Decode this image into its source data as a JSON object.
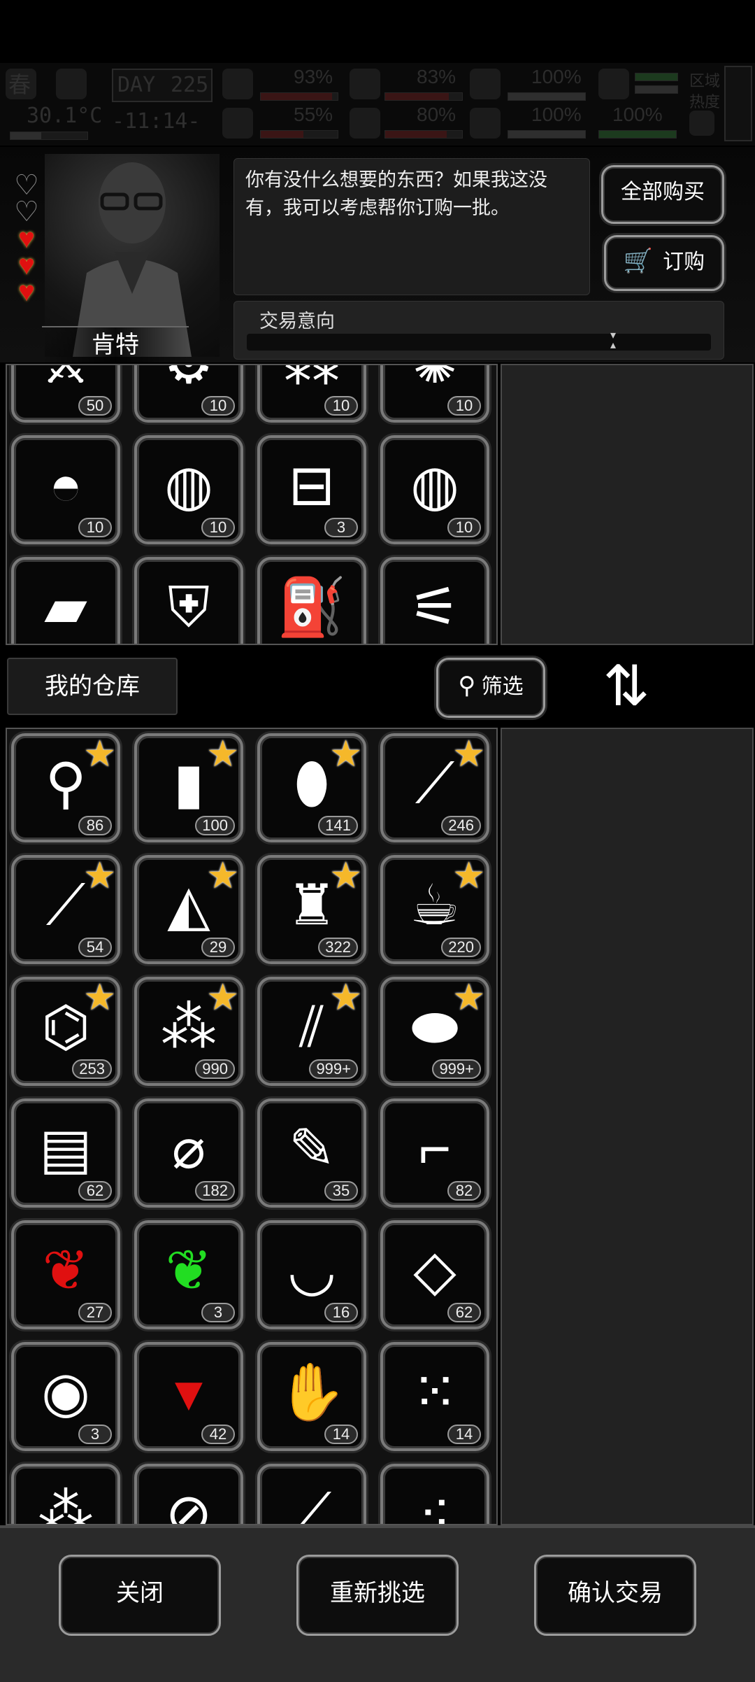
{
  "status": {
    "season": "春",
    "day_label": "DAY",
    "day_value": "225",
    "temperature": "30.1°C",
    "clock": "-11:14-",
    "stats": [
      {
        "name": "medkit",
        "value": "93%"
      },
      {
        "name": "stomach",
        "value": "83%"
      },
      {
        "name": "battery",
        "value": "100%"
      },
      {
        "name": "brain",
        "value": "55%"
      },
      {
        "name": "water",
        "value": "80%"
      },
      {
        "name": "heart",
        "value": "100%"
      },
      {
        "name": "radiation",
        "value": "100%"
      }
    ],
    "zone_heat_line1": "区域",
    "zone_heat_line2": "热度"
  },
  "npc": {
    "name": "肯特",
    "dialog": "你有没什么想要的东西？如果我这没有，我可以考虑帮你订购一批。",
    "hearts": {
      "filled": 3,
      "total": 5
    },
    "buy_all_label": "全部购买",
    "order_label": "订购",
    "trade_pref_label": "交易意向"
  },
  "trader_items": [
    {
      "icon": "spikes-icon",
      "glyph": "⚔",
      "count": "50"
    },
    {
      "icon": "gears-icon",
      "glyph": "⚙",
      "count": "10"
    },
    {
      "icon": "scrap-icon",
      "glyph": "⁂",
      "count": "10"
    },
    {
      "icon": "fur-icon",
      "glyph": "✺",
      "count": "10"
    },
    {
      "icon": "net-helmet-icon",
      "glyph": "◓",
      "count": "10"
    },
    {
      "icon": "net-trap-icon",
      "glyph": "◍",
      "count": "10"
    },
    {
      "icon": "toolbox-icon",
      "glyph": "⊟",
      "count": "3"
    },
    {
      "icon": "net-trap-icon",
      "glyph": "◍",
      "count": "10"
    },
    {
      "icon": "cloth-icon",
      "glyph": "▰",
      "count": ""
    },
    {
      "icon": "jacket-icon",
      "glyph": "⛨",
      "count": ""
    },
    {
      "icon": "gas-can-icon",
      "glyph": "⛽",
      "count": ""
    },
    {
      "icon": "knife-icon",
      "glyph": "⚟",
      "count": ""
    }
  ],
  "warehouse": {
    "title": "我的仓库",
    "filter_label": "筛选",
    "items": [
      {
        "icon": "kebab-icon",
        "glyph": "⚲",
        "count": "86",
        "star": true
      },
      {
        "icon": "water-bottle-icon",
        "glyph": "▮",
        "count": "100",
        "star": true
      },
      {
        "icon": "pill-bottle-icon",
        "glyph": "⬮",
        "count": "141",
        "star": true
      },
      {
        "icon": "cigar-icon",
        "glyph": "⟋",
        "count": "246",
        "star": true
      },
      {
        "icon": "cigarette-icon",
        "glyph": "⟋",
        "count": "54",
        "star": true
      },
      {
        "icon": "meat-slice-icon",
        "glyph": "◭",
        "count": "29",
        "star": true
      },
      {
        "icon": "liquor-bottle-icon",
        "glyph": "♜",
        "count": "322",
        "star": true
      },
      {
        "icon": "coffee-cup-icon",
        "glyph": "☕",
        "count": "220",
        "star": true
      },
      {
        "icon": "paper-roll-icon",
        "glyph": "⌬",
        "count": "253",
        "star": true
      },
      {
        "icon": "bottles-icon",
        "glyph": "⁂",
        "count": "990",
        "star": true
      },
      {
        "icon": "glass-bottle-icon",
        "glyph": "⫽",
        "count": "999+",
        "star": true
      },
      {
        "icon": "potato-icon",
        "glyph": "⬬",
        "count": "999+",
        "star": true
      },
      {
        "icon": "towel-icon",
        "glyph": "▤",
        "count": "62",
        "star": false
      },
      {
        "icon": "bandage-icon",
        "glyph": "⌀",
        "count": "182",
        "star": false
      },
      {
        "icon": "syringe-icon",
        "glyph": "✎",
        "count": "35",
        "star": false
      },
      {
        "icon": "flare-gun-icon",
        "glyph": "⌐",
        "count": "82",
        "star": false
      },
      {
        "icon": "red-herb-icon",
        "glyph": "❦",
        "count": "27",
        "star": false,
        "color": "#e01010"
      },
      {
        "icon": "green-herb-icon",
        "glyph": "❦",
        "count": "3",
        "star": false,
        "color": "#22dd22"
      },
      {
        "icon": "bowl-icon",
        "glyph": "◡",
        "count": "16",
        "star": false
      },
      {
        "icon": "tray-icon",
        "glyph": "◇",
        "count": "62",
        "star": false
      },
      {
        "icon": "gas-mask-icon",
        "glyph": "◉",
        "count": "3",
        "star": false
      },
      {
        "icon": "cup-icon",
        "glyph": "▾",
        "count": "42",
        "star": false,
        "color": "#e01010"
      },
      {
        "icon": "ginger-icon",
        "glyph": "✋",
        "count": "14",
        "star": false
      },
      {
        "icon": "seeds-icon",
        "glyph": "⁙",
        "count": "14",
        "star": false
      },
      {
        "icon": "nuts-icon",
        "glyph": "⁂",
        "count": "",
        "star": false
      },
      {
        "icon": "pills-icon",
        "glyph": "⊘",
        "count": "",
        "star": false
      },
      {
        "icon": "spray-icon",
        "glyph": "⟋",
        "count": "",
        "star": false
      },
      {
        "icon": "capsules-icon",
        "glyph": "⁖",
        "count": "",
        "star": false
      }
    ]
  },
  "bottom": {
    "close_label": "关闭",
    "reselect_label": "重新挑选",
    "confirm_label": "确认交易"
  }
}
